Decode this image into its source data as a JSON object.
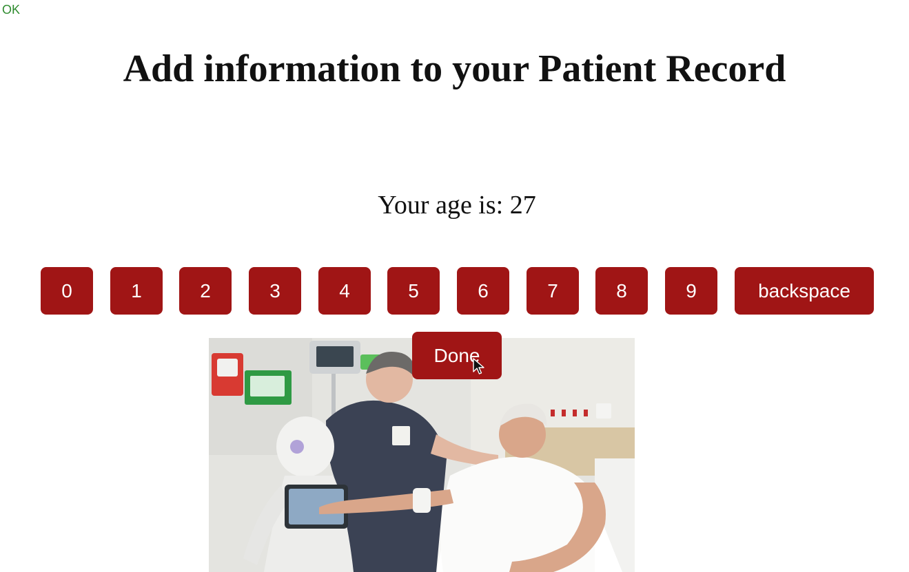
{
  "status": {
    "text": "OK",
    "color": "#2e8b2e"
  },
  "page": {
    "title": "Add information to your Patient Record"
  },
  "age": {
    "label": "Your age is:",
    "value": "27"
  },
  "keypad": {
    "keys": [
      "0",
      "1",
      "2",
      "3",
      "4",
      "5",
      "6",
      "7",
      "8",
      "9"
    ],
    "backspace": "backspace",
    "color": "#a01515"
  },
  "done": {
    "label": "Done"
  },
  "photo": {
    "subject": "nurse and patient using robot tablet in hospital room"
  },
  "cursor": {
    "icon": "mouse-pointer-icon"
  }
}
